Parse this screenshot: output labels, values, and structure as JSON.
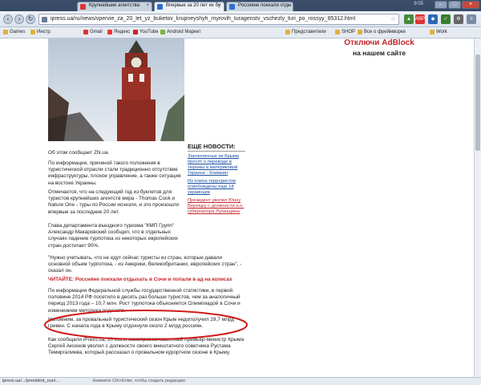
{
  "browser": {
    "tabs": [
      {
        "label": "Крупнейшие агентства"
      },
      {
        "label": "Впервые за 20 лет их бу"
      },
      {
        "label": "Россияне поехали отды"
      }
    ],
    "clock": "9:05",
    "url": "ipress.ua/ru/news/vpervie_za_20_let_yz_buketov_krupneyshyh_myrovih_turagenstv_vschezly_turi_po_rossyy_85312.html",
    "bookmarks": [
      {
        "label": "Games"
      },
      {
        "label": "Инстр."
      },
      {
        "label": "Gmail"
      },
      {
        "label": "Яндекс"
      },
      {
        "label": "YouTube"
      },
      {
        "label": "Android Маркет"
      },
      {
        "label": "Представители"
      },
      {
        "label": "SHOP"
      },
      {
        "label": "Все о фреймворке"
      },
      {
        "label": "Work"
      }
    ]
  },
  "article": {
    "source_line": "Об этом сообщает ZN.ua.",
    "paragraphs": [
      "По информации, причиной такого положения в туристической отрасли стали традиционно отсутствие инфраструктуры, плохое управление, а также ситуация на востоке Украины.",
      "Отмечается, что на следующий год из буклетов для туристов крупнейших агентств мира - Thomas Cook и Nature One - туры по России исчезли, и это произошло впервые за последние 20 лет.",
      "Глава департамента въездного туризма \"КМП Групп\" Александр Макаровский сообщил, что в отдельных случаях падение турпотока из некоторых европейских стран достигает 90%.",
      "\"Нужно учитывать, что не едут сейчас туристы из стран, которые давали основной объем турпотока, - из Америки, Великобритании, европейских стран\", - сказал он.",
      "ЧИТАЙТЕ: Россияне поехали отдыхать в Сочи и попали в ад на колесах",
      "По информации Федеральной службы государственной статистики, в первой половине 2014 РФ посетило в десять раз больше туристов, чем за аналогичный период 2013 года – 10,7 млн. Рост турпотока объясняется Олимпиадой в Сочи и изменением методики подсчета.",
      "Напомним, за провальный туристический сезон Крым недополучил 29,7 млрд гривен. С начала года в Крыму отдохнули около 2 млрд россиян.",
      "Как сообщали iPress.ua, 20 июля самопровозглашенный премьер-министр Крыма Сергей Аксенов уволил с должности своего внештатного советника Рустама Темиргалиева, который рассказал о провальном курортном сезоне в Крыму."
    ]
  },
  "status": {
    "left": "ipress.ua/.../president_oun/...",
    "hint": "Нажмите Ctrl+Enter, чтобы создать редакцию"
  },
  "right": {
    "ad_title": "Отключи AdBlock",
    "ad_sub": "на нашем сайте"
  },
  "mid": {
    "news_head": "ЕЩЕ НОВОСТИ:",
    "news": [
      "Заключенные из Крыма просят о переводе в тюрьмы в материковой Украине - Климкин",
      "Из плена террористов освобождены еще 14 украинцев",
      "Президент уволил Юнну Вереіцку с должности и.о. губернатора Луганщины"
    ]
  }
}
